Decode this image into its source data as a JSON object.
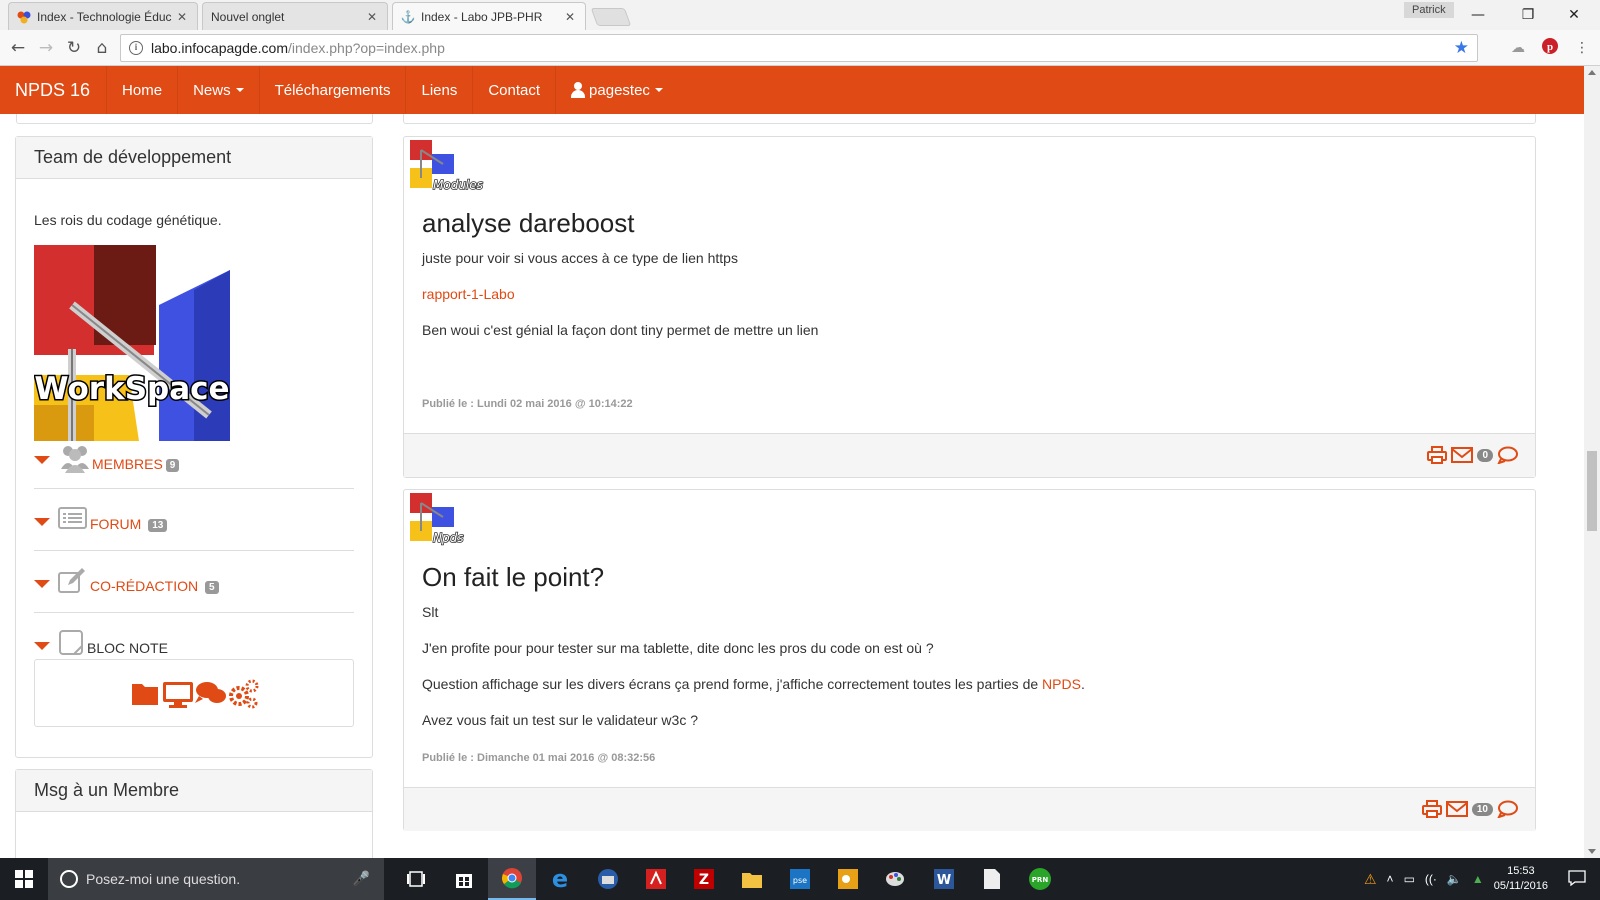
{
  "browser": {
    "tabs": [
      {
        "title": "Index - Technologie Éduc",
        "active": false
      },
      {
        "title": "Nouvel onglet",
        "active": false
      },
      {
        "title": "Index - Labo JPB-PHR",
        "active": true
      }
    ],
    "profile": "Patrick",
    "window_controls": {
      "minimize": "—",
      "restore": "❐",
      "close": "✕"
    },
    "url_host": "labo.infocapagde.com",
    "url_path": "/index.php?op=index.php",
    "accent": "#3b78e7"
  },
  "site": {
    "brand": "NPDS 16",
    "brand_color": "#e04a14",
    "nav": [
      {
        "label": "Home",
        "dropdown": false
      },
      {
        "label": "News",
        "dropdown": true
      },
      {
        "label": "Téléchargements",
        "dropdown": false
      },
      {
        "label": "Liens",
        "dropdown": false
      },
      {
        "label": "Contact",
        "dropdown": false
      }
    ],
    "user": {
      "label": "pagestec",
      "icon": "user-icon"
    }
  },
  "sidebar": {
    "team": {
      "title": "Team de développement",
      "description": "Les rois du codage génétique.",
      "image_text": "WorkSpace",
      "items": [
        {
          "label": "MEMBRES",
          "badge": "9",
          "icon": "users-icon",
          "accent": true
        },
        {
          "label": "FORUM",
          "badge": "13",
          "icon": "list-icon",
          "accent": true
        },
        {
          "label": "CO-RÉDACTION",
          "badge": "5",
          "icon": "edit-icon",
          "accent": true
        },
        {
          "label": "BLOC NOTE",
          "badge": "",
          "icon": "note-icon",
          "accent": false
        }
      ]
    },
    "msg_title": "Msg à un Membre"
  },
  "articles": [
    {
      "category": "Modules",
      "title": "analyse dareboost",
      "paragraphs": [
        "juste pour voir si vous acces à ce type de lien https"
      ],
      "link": "rapport-1-Labo",
      "paragraph_after": "Ben woui c'est génial la façon dont tiny permet de mettre un lien",
      "meta": "Publié le : Lundi 02 mai 2016 @ 10:14:22",
      "comments": "0"
    },
    {
      "category": "Npds",
      "title": "On fait le point?",
      "line1": "Slt",
      "line2": "J'en profite pour pour tester sur ma tablette, dite donc les pros du code on est où ?",
      "line3_before": "Question affichage sur les divers écrans ça prend forme, j'affiche correctement toutes les parties de ",
      "line3_link": "NPDS",
      "line3_after": ".",
      "line4": "Avez vous fait un test sur le validateur w3c ?",
      "meta": "Publié le : Dimanche 01 mai 2016 @ 08:32:56",
      "comments": "10"
    }
  ],
  "taskbar": {
    "search_placeholder": "Posez-moi une question.",
    "time": "15:53",
    "date": "05/11/2016",
    "apps": [
      "task-view-icon",
      "store-icon",
      "chrome-icon",
      "edge-icon",
      "thunderbird-icon",
      "acrobat-icon",
      "filezilla-icon",
      "explorer-icon",
      "photoshop-elements-icon",
      "outlook-icon",
      "paint-icon",
      "word-icon",
      "notepad-icon",
      "prn-icon"
    ]
  }
}
